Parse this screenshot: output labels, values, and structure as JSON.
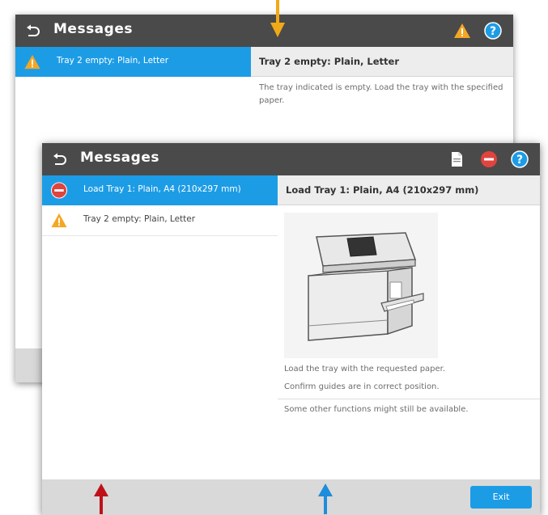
{
  "colors": {
    "title_bar": "#4a4a4a",
    "selection_blue": "#1d9ce6",
    "warning_yellow": "#f5a623",
    "error_red": "#e0443e",
    "footer_gray": "#d9d9d9",
    "arrow_orange": "#f2a917",
    "arrow_red": "#c0111a",
    "arrow_blue": "#1e8ddb"
  },
  "back_screen": {
    "title": "Messages",
    "header_icons": [
      "warning-icon",
      "help-icon"
    ],
    "messages": [
      {
        "label": "Tray 2 empty: Plain, Letter",
        "icon": "warning-icon",
        "selected": true
      }
    ],
    "detail": {
      "heading": "Tray 2 empty: Plain, Letter",
      "text": "The tray indicated is empty. Load the tray with the specified paper."
    }
  },
  "front_screen": {
    "title": "Messages",
    "header_icons": [
      "document-icon",
      "error-icon",
      "help-icon"
    ],
    "messages": [
      {
        "label": "Load Tray 1: Plain, A4 (210x297 mm)",
        "icon": "error-icon",
        "selected": true
      },
      {
        "label": "Tray 2 empty: Plain, Letter",
        "icon": "warning-icon",
        "selected": false
      }
    ],
    "detail": {
      "heading": "Load Tray 1: Plain, A4 (210x297 mm)",
      "line1": "Load the tray with the requested paper.",
      "line2": "Confirm guides are in correct position.",
      "note": "Some other functions might still be available."
    },
    "exit_label": "Exit"
  }
}
